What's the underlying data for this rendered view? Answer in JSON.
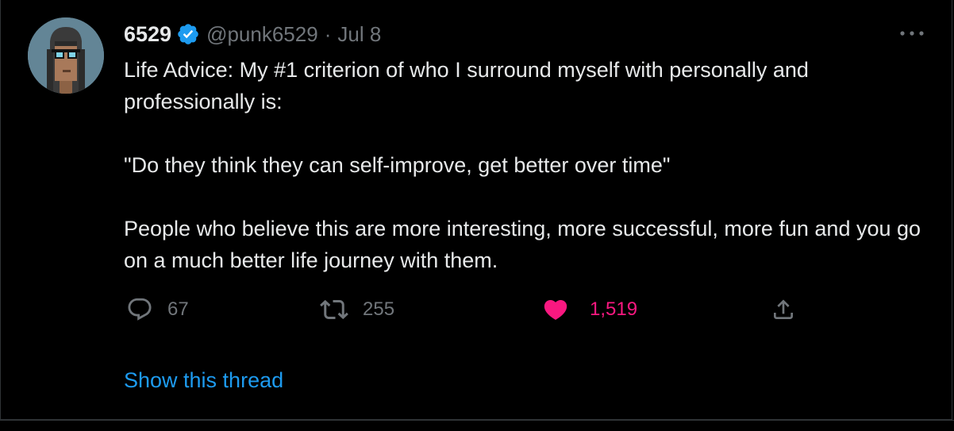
{
  "tweet": {
    "display_name": "6529",
    "handle": "@punk6529",
    "separator": "·",
    "date": "Jul 8",
    "paragraphs": [
      "Life Advice: My #1 criterion of who I surround myself with personally and professionally is:",
      "\"Do they think they can self-improve, get better over time\"",
      "People who believe this are more interesting, more successful, more fun and you go on a much better life journey with them."
    ],
    "actions": {
      "reply_count": "67",
      "retweet_count": "255",
      "like_count": "1,519"
    },
    "show_thread_label": "Show this thread"
  },
  "icons": {
    "verified": "verified-badge-icon",
    "more": "more-horizontal-icon",
    "reply": "reply-bubble-icon",
    "retweet": "retweet-arrows-icon",
    "like": "heart-filled-icon",
    "share": "share-upload-icon"
  },
  "colors": {
    "background": "#000000",
    "text": "#e7e9ea",
    "secondary": "#71767b",
    "link": "#1d9bf0",
    "like": "#f91880",
    "verified": "#1d9bf0"
  }
}
